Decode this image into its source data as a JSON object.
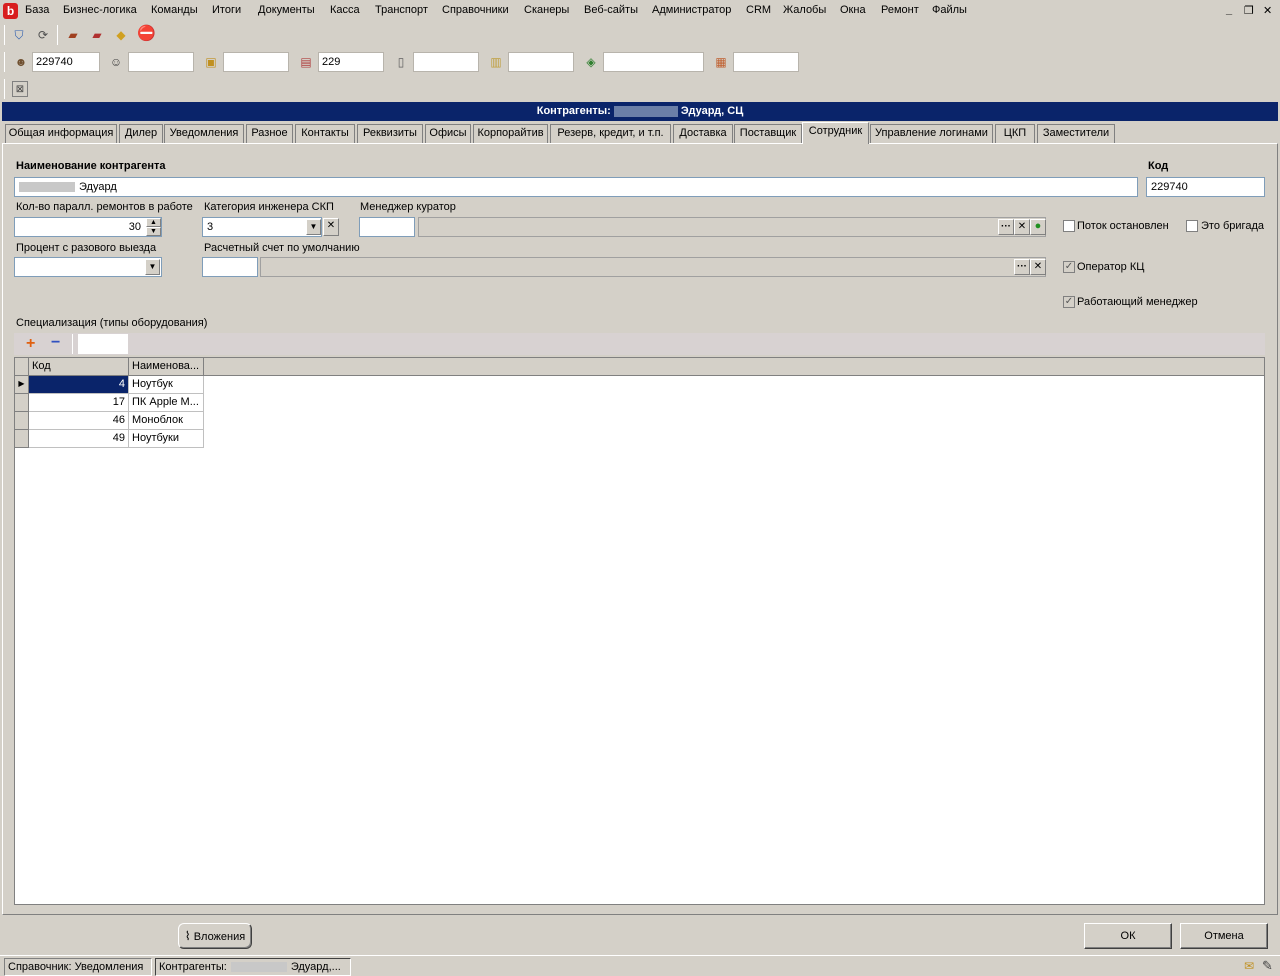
{
  "menubar": {
    "items": [
      "База",
      "Бизнес-логика",
      "Команды",
      "Итоги",
      "Документы",
      "Касса",
      "Транспорт",
      "Справочники",
      "Сканеры",
      "Веб-сайты",
      "Администратор",
      "CRM",
      "Жалобы",
      "Окна",
      "Ремонт",
      "Файлы"
    ],
    "logo_glyph": "b"
  },
  "toolbar2": {
    "fields": [
      "229740",
      "",
      "",
      "229",
      "",
      "",
      "",
      ""
    ]
  },
  "window": {
    "title_prefix": "Контрагенты:",
    "title_suffix": "Эдуард, СЦ"
  },
  "tabs": [
    "Общая информация",
    "Дилер",
    "Уведомления",
    "Разное",
    "Контакты",
    "Реквизиты",
    "Офисы",
    "Корпорайтив",
    "Резерв, кредит, и т.п.",
    "Доставка",
    "Поставщик",
    "Сотрудник",
    "Управление логинами",
    "ЦКП",
    "Заместители"
  ],
  "active_tab": "Сотрудник",
  "form": {
    "name_label": "Наименование контрагента",
    "name_value": "Эдуард",
    "code_label": "Код",
    "code_value": "229740",
    "parallel_label": "Кол-во паралл. ремонтов в работе",
    "parallel_value": "30",
    "engineer_cat_label": "Категория инженера СКП",
    "engineer_cat_value": "3",
    "manager_label": "Менеджер куратор",
    "manager_code": "",
    "manager_name": "",
    "percent_label": "Процент с разового выезда",
    "percent_value": "",
    "account_label": "Расчетный счет по умолчанию",
    "account_code": "",
    "account_name": "",
    "flow_stopped_label": "Поток остановлен",
    "is_team_label": "Это бригада",
    "operator_kc_label": "Оператор КЦ",
    "working_manager_label": "Работающий менеджер",
    "flow_stopped_checked": false,
    "is_team_checked": false,
    "operator_kc_checked": true,
    "working_manager_checked": true,
    "ellipsis": "···",
    "clear": "✕"
  },
  "specialization": {
    "label": "Специализация (типы оборудования)",
    "filter_value": "",
    "columns": [
      "Код",
      "Наименова..."
    ],
    "rows": [
      {
        "code": "4",
        "name": "Ноутбук"
      },
      {
        "code": "17",
        "name": "ПК Apple M..."
      },
      {
        "code": "46",
        "name": "Моноблок"
      },
      {
        "code": "49",
        "name": "Ноутбуки"
      }
    ]
  },
  "bottom": {
    "attachments_label": "Вложения",
    "ok_label": "ОК",
    "cancel_label": "Отмена"
  },
  "status": {
    "panel1": "Справочник: Уведомления",
    "panel2_prefix": "Контрагенты:",
    "panel2_suffix": "Эдуард,..."
  },
  "colors": {
    "title_bg": "#0a246a",
    "selection_bg": "#0a246a",
    "face": "#d4d0c8"
  }
}
